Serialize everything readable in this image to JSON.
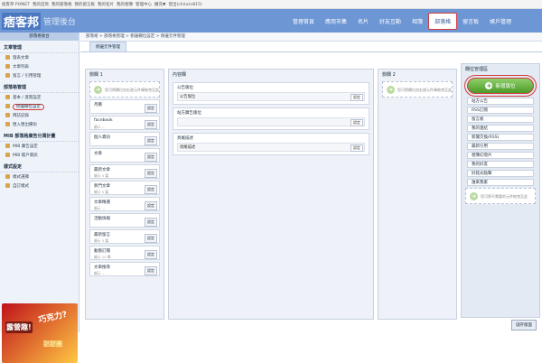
{
  "topbar": {
    "items": [
      "痞客邦 PIXNET",
      "我的首頁",
      "我的部落格",
      "我的留言板",
      "我的名片",
      "我的相簿",
      "管理中心",
      "擴充▼",
      "登出(chincin815)"
    ]
  },
  "header": {
    "brand": "痞客邦",
    "subtitle": "管理後台",
    "nav": [
      "管理首頁",
      "應用市集",
      "名片",
      "好友互動",
      "相簿",
      "部落格",
      "留言板",
      "帳戶管理"
    ],
    "active_nav": "部落格"
  },
  "annotations": {
    "n1": "1",
    "n2": "2",
    "n3": "3"
  },
  "sidebar": {
    "title": "部落格後台",
    "sections": [
      {
        "title": "文章管理",
        "items": [
          "發表文章",
          "文章列表",
          "留言 / 引用管理"
        ]
      },
      {
        "title": "部落格管理",
        "items": [
          "基本 / 進階設定",
          "側邊欄位設定",
          "拜訪記錄",
          "匯入匯出備份"
        ],
        "highlight": "側邊欄位設定"
      },
      {
        "title": "MIB 部落格廣告分潤計畫",
        "items": [
          "MIB 廣告設定",
          "MIB 帳戶資訊"
        ]
      },
      {
        "title": "樣式設定",
        "items": [
          "樣式選擇",
          "自訂樣式"
        ]
      }
    ]
  },
  "promo": {
    "t1": "巧克力?",
    "t2": "露營趣!",
    "t3": "甜甜圈"
  },
  "main": {
    "breadcrumb": "部落格 > 部落格管理 > 側邊欄位設定 > 側邊元件管理",
    "tab": "側邊元件管理",
    "col1": {
      "title": "側欄 1",
      "hint": "您可將欄位由右邊元件庫拖曳至此",
      "widgets": [
        {
          "name": "月曆",
          "sub": ""
        },
        {
          "name": "facebook",
          "sub": "顯示 ..."
        },
        {
          "name": "個人資訊",
          "sub": ""
        },
        {
          "name": "文章",
          "sub": ""
        },
        {
          "name": "最新文章",
          "sub": "顯示 5 篇"
        },
        {
          "name": "熱門文章",
          "sub": "顯示 5 篇"
        },
        {
          "name": "文章精選",
          "sub": "顯示 ..."
        },
        {
          "name": "活動快報",
          "sub": ""
        },
        {
          "name": "最新留言",
          "sub": "顯示 5 篇"
        },
        {
          "name": "動態訂閱",
          "sub": "顯示 10 筆"
        },
        {
          "name": "文章搜尋",
          "sub": "顯示 ..."
        }
      ],
      "button": "設定"
    },
    "content": {
      "title": "內容欄",
      "blocks": [
        {
          "title": "公告版位",
          "row": "公告版位"
        },
        {
          "title": "站方廣告版位",
          "row": ""
        },
        {
          "title": "頁尾描述",
          "row": "頁尾描述"
        }
      ]
    },
    "col2": {
      "title": "側欄 2",
      "hint": "您可將欄位由右邊元件庫拖曳至此"
    },
    "pool": {
      "title": "欄位管理區",
      "add_button": "新增版位",
      "items": [
        "站方公告",
        "RSS訂閱",
        "留言板",
        "我的連結",
        "新聞交換(RSS)",
        "最新引用",
        "相簿幻燈片",
        "我的好友",
        "好銘光點擊",
        "誰來我家"
      ],
      "hint": "您可將不需要的元件拖曳至此"
    },
    "save": "儲存版面"
  }
}
